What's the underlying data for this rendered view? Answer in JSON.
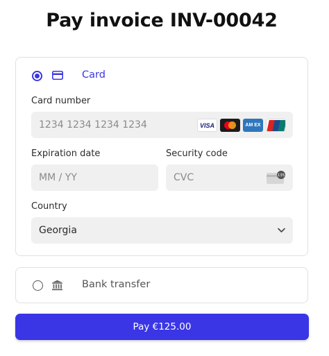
{
  "page": {
    "title": "Pay invoice INV-00042"
  },
  "payment_methods": [
    {
      "label": "Card",
      "selected": true,
      "icon": "credit-card-icon"
    },
    {
      "label": "Bank transfer",
      "selected": false,
      "icon": "bank-icon"
    }
  ],
  "card_form": {
    "card_number": {
      "label": "Card number",
      "placeholder": "1234 1234 1234 1234"
    },
    "brands": {
      "visa": "VISA",
      "mastercard": "mastercard-icon",
      "amex": "AM EX",
      "unionpay": "UnionPay"
    },
    "expiration": {
      "label": "Expiration date",
      "placeholder": "MM / YY"
    },
    "security_code": {
      "label": "Security code",
      "placeholder": "CVC",
      "icon_text": "135"
    },
    "country": {
      "label": "Country",
      "value": "Georgia"
    }
  },
  "pay_button": {
    "label": "Pay €125.00"
  },
  "colors": {
    "accent": "#3a36e6",
    "input_bg": "#f0f0f0",
    "border": "#e0e0e0"
  }
}
